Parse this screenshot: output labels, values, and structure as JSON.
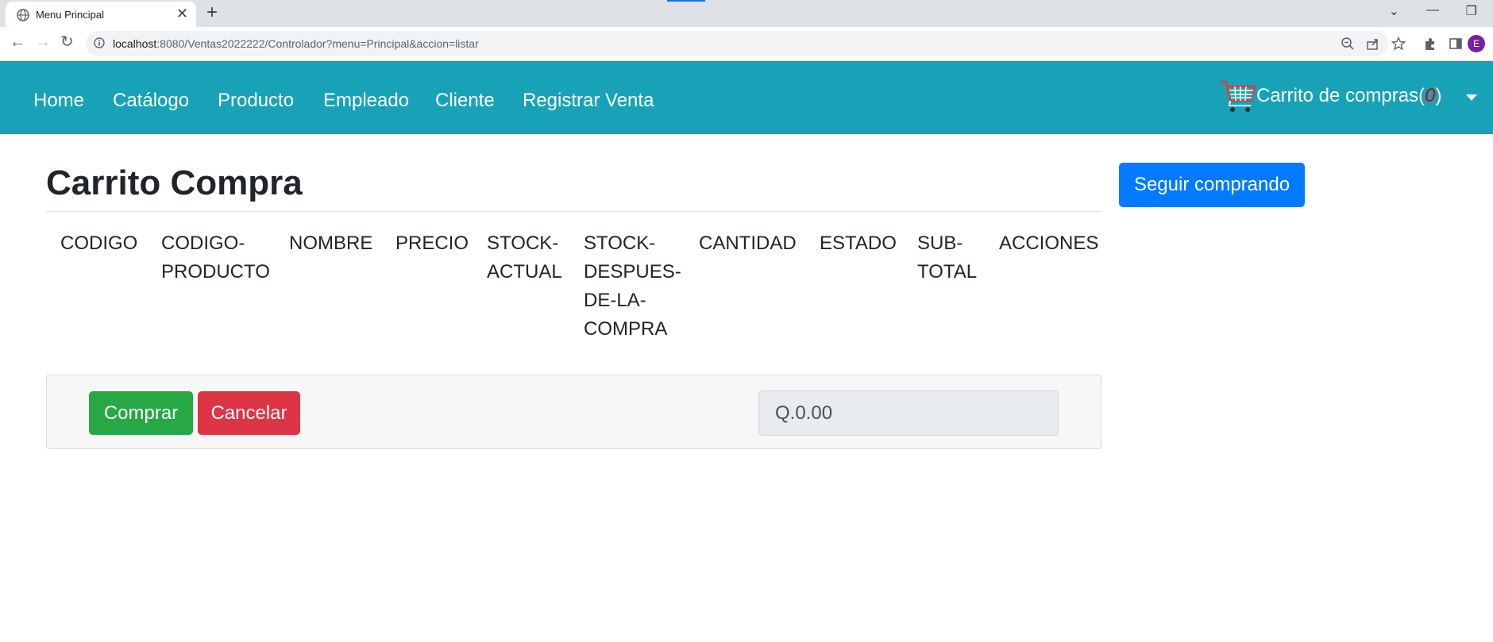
{
  "browser": {
    "tab_title": "Menu Principal",
    "tab_close": "✕",
    "new_tab": "+",
    "url_host": "localhost",
    "url_rest": ":8080/Ventas2022222/Controlador?menu=Principal&accion=listar",
    "profile_initial": "E",
    "controls": {
      "chevron": "⌄",
      "minimize": "—",
      "restore": "❐"
    },
    "nav": {
      "back": "←",
      "forward": "→",
      "reload": "↻"
    }
  },
  "navbar": {
    "links": [
      "Home",
      "Catálogo",
      "Producto",
      "Empleado",
      "Cliente",
      "Registrar Venta"
    ],
    "cart_label": "Carrito de compras",
    "cart_open": "(",
    "cart_count": "0",
    "cart_close": ")",
    "color": "#17a2b8"
  },
  "page": {
    "title": "Carrito Compra",
    "continue_button": "Seguir comprando"
  },
  "table": {
    "headers": [
      [
        "CODIGO"
      ],
      [
        "CODIGO-",
        "PRODUCTO"
      ],
      [
        "NOMBRE"
      ],
      [
        "PRECIO"
      ],
      [
        "STOCK-",
        "ACTUAL"
      ],
      [
        "STOCK-",
        "DESPUES-",
        "DE-LA-",
        "COMPRA"
      ],
      [
        "CANTIDAD"
      ],
      [
        "ESTADO"
      ],
      [
        "SUB-",
        "TOTAL"
      ],
      [
        "ACCIONES"
      ]
    ]
  },
  "footer_card": {
    "buy_button": "Comprar",
    "cancel_button": "Cancelar",
    "total_value": "Q.0.00"
  },
  "colors": {
    "primary": "#007bff",
    "success": "#28a745",
    "danger": "#dc3545",
    "cart_count": "#d50000"
  }
}
